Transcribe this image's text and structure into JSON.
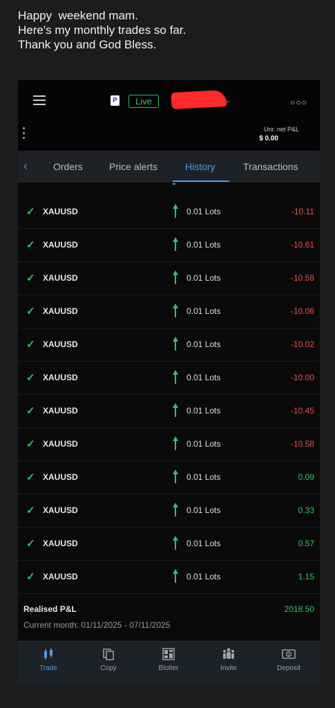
{
  "message": {
    "line1": "Happy  weekend mam.",
    "line2": "Here's my monthly trades so far.",
    "line3": "Thank you and God Bless."
  },
  "header": {
    "logo_letter": "P",
    "account_badge": "Live",
    "more_icon": "more-horizontal-icon"
  },
  "summary": {
    "pnl_label": "Unr. net P&L",
    "pnl_value": "$ 0.00"
  },
  "tabs": [
    {
      "label": "Orders"
    },
    {
      "label": "Price alerts"
    },
    {
      "label": "History",
      "active": true
    },
    {
      "label": "Transactions"
    }
  ],
  "trades": [
    {
      "symbol": "XAUUSD",
      "lots": "0.01 Lots",
      "pl": "-10.11",
      "direction": "buy"
    },
    {
      "symbol": "XAUUSD",
      "lots": "0.01 Lots",
      "pl": "-10.61",
      "direction": "buy"
    },
    {
      "symbol": "XAUUSD",
      "lots": "0.01 Lots",
      "pl": "-10.58",
      "direction": "buy"
    },
    {
      "symbol": "XAUUSD",
      "lots": "0.01 Lots",
      "pl": "-10.06",
      "direction": "buy"
    },
    {
      "symbol": "XAUUSD",
      "lots": "0.01 Lots",
      "pl": "-10.02",
      "direction": "buy"
    },
    {
      "symbol": "XAUUSD",
      "lots": "0.01 Lots",
      "pl": "-10.00",
      "direction": "buy"
    },
    {
      "symbol": "XAUUSD",
      "lots": "0.01 Lots",
      "pl": "-10.45",
      "direction": "buy"
    },
    {
      "symbol": "XAUUSD",
      "lots": "0.01 Lots",
      "pl": "-10.58",
      "direction": "buy"
    },
    {
      "symbol": "XAUUSD",
      "lots": "0.01 Lots",
      "pl": "0.09",
      "direction": "buy"
    },
    {
      "symbol": "XAUUSD",
      "lots": "0.01 Lots",
      "pl": "0.33",
      "direction": "buy"
    },
    {
      "symbol": "XAUUSD",
      "lots": "0.01 Lots",
      "pl": "0.57",
      "direction": "buy"
    },
    {
      "symbol": "XAUUSD",
      "lots": "0.01 Lots",
      "pl": "1.15",
      "direction": "buy"
    }
  ],
  "realised": {
    "label": "Realised P&L",
    "value": "2018.50",
    "period": "Current month: 01/11/2025 - 07/11/2025"
  },
  "bottom_nav": [
    {
      "label": "Trade",
      "icon": "candlestick-icon",
      "active": true
    },
    {
      "label": "Copy",
      "icon": "copy-icon"
    },
    {
      "label": "Blotter",
      "icon": "blotter-grid-icon"
    },
    {
      "label": "Invite",
      "icon": "invite-people-icon"
    },
    {
      "label": "Deposit",
      "icon": "deposit-cash-icon"
    }
  ],
  "colors": {
    "positive": "#34c45f",
    "negative": "#e8514a",
    "accent": "#4a9cf0"
  }
}
